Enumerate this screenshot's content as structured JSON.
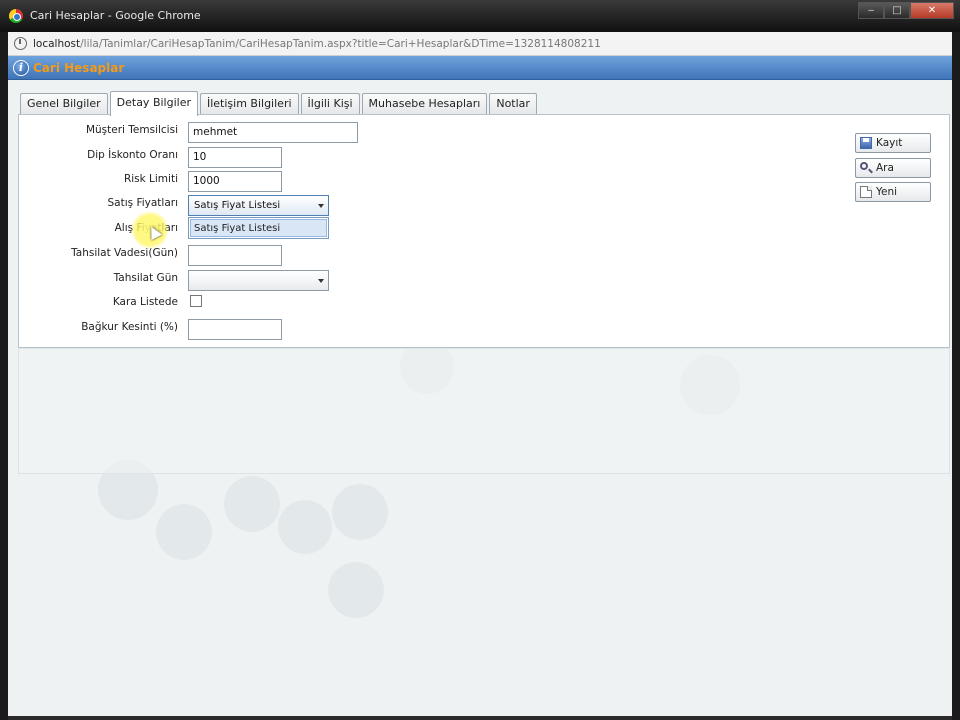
{
  "window": {
    "title": "Cari Hesaplar - Google Chrome",
    "minimize": "‒",
    "maximize": "□",
    "close": "✕"
  },
  "address": {
    "host": "localhost",
    "path": "/lila/Tanimlar/CariHesapTanim/CariHesapTanim.aspx?title=Cari+Hesaplar&DTime=1328114808211"
  },
  "app": {
    "title": "Cari Hesaplar",
    "info_glyph": "i"
  },
  "tabs": [
    {
      "label": "Genel Bilgiler",
      "active": false
    },
    {
      "label": "Detay Bilgiler",
      "active": true
    },
    {
      "label": "İletişim Bilgileri",
      "active": false
    },
    {
      "label": "İlgili Kişi",
      "active": false
    },
    {
      "label": "Muhasebe Hesapları",
      "active": false
    },
    {
      "label": "Notlar",
      "active": false
    }
  ],
  "form": {
    "musteri_temsilcisi": {
      "label": "Müşteri Temsilcisi",
      "value": "mehmet"
    },
    "dip_iskonto": {
      "label": "Dip İskonto Oranı",
      "value": "10"
    },
    "risk_limiti": {
      "label": "Risk Limiti",
      "value": "1000"
    },
    "satis_fiyatlari": {
      "label": "Satış Fiyatları",
      "value": "Satış Fiyat Listesi"
    },
    "alis_fiyatlari": {
      "label": "Alış Fiyatları",
      "dropdown_option": "Satış Fiyat Listesi"
    },
    "tahsilat_vadesi": {
      "label": "Tahsilat Vadesi(Gün)",
      "value": ""
    },
    "tahsilat_gun": {
      "label": "Tahsilat Gün",
      "value": ""
    },
    "kara_listede": {
      "label": "Kara Listede",
      "checked": false
    },
    "bagkur_kesinti": {
      "label": "Bağkur Kesinti (%)",
      "value": ""
    }
  },
  "actions": {
    "save": {
      "label": "Kayıt",
      "icon": "save-icon"
    },
    "search": {
      "label": "Ara",
      "icon": "search-icon"
    },
    "new": {
      "label": "Yeni",
      "icon": "new-document-icon"
    }
  },
  "colors": {
    "header_blue": "#4f86c9",
    "title_orange": "#f39a1a",
    "focus_border": "#4f7fb5"
  }
}
